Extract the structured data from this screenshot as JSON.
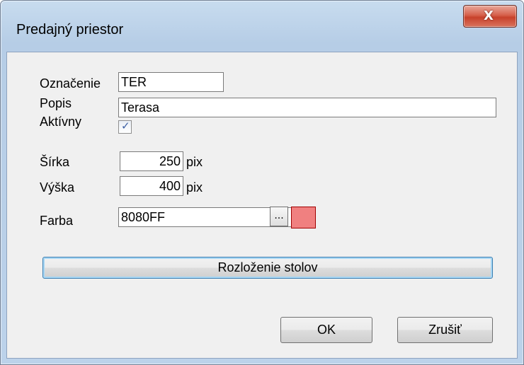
{
  "window": {
    "title": "Predajný priestor",
    "close_label": "X"
  },
  "form": {
    "oznacenie_label": "Označenie",
    "oznacenie_value": "TER",
    "popis_label": "Popis",
    "popis_value": "Terasa",
    "aktivny_label": "Aktívny",
    "aktivny_checked": true,
    "sirka_label": "Šírka",
    "sirka_value": "250",
    "vyska_label": "Výška",
    "vyska_value": "400",
    "unit_label": "pix",
    "farba_label": "Farba",
    "farba_value": "8080FF",
    "farba_button_label": "...",
    "swatch_color": "#f08080"
  },
  "buttons": {
    "layout_label": "Rozloženie stolov",
    "ok_label": "OK",
    "cancel_label": "Zrušiť"
  },
  "icons": {
    "close": "close-icon",
    "check": "checkmark-icon"
  }
}
